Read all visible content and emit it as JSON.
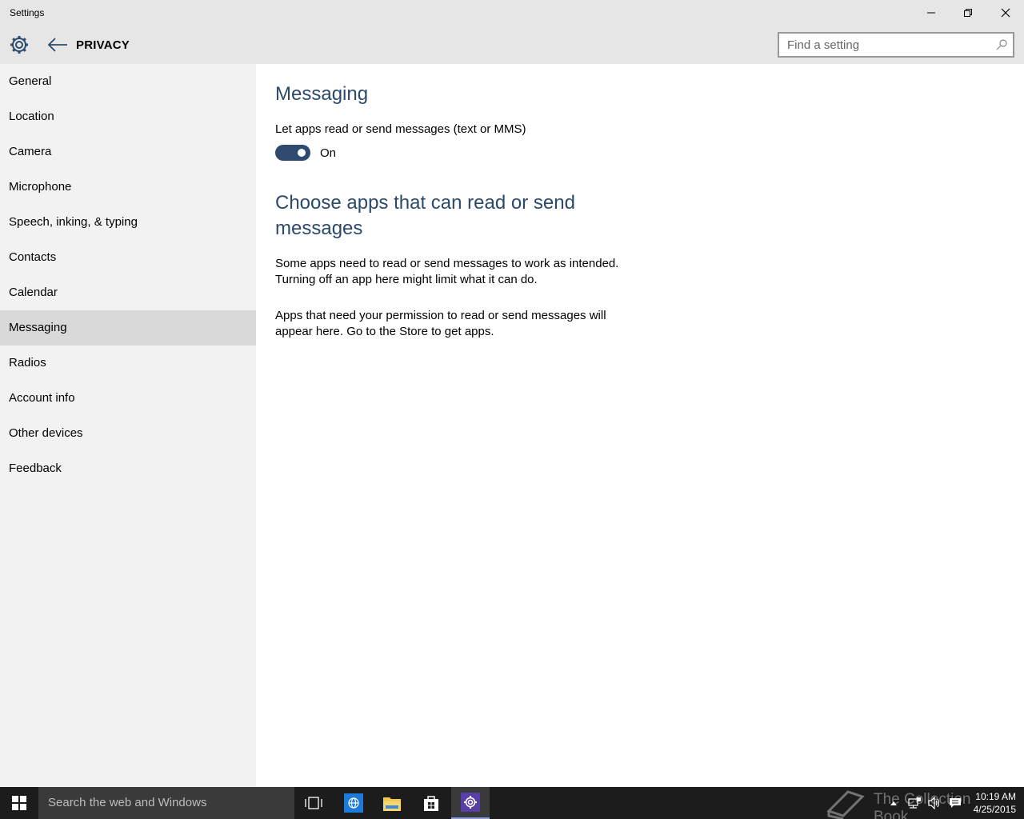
{
  "window": {
    "title": "Settings"
  },
  "header": {
    "section_title": "PRIVACY",
    "search_placeholder": "Find a setting"
  },
  "sidebar": {
    "items": [
      {
        "label": "General"
      },
      {
        "label": "Location"
      },
      {
        "label": "Camera"
      },
      {
        "label": "Microphone"
      },
      {
        "label": "Speech, inking, & typing"
      },
      {
        "label": "Contacts"
      },
      {
        "label": "Calendar"
      },
      {
        "label": "Messaging",
        "selected": true
      },
      {
        "label": "Radios"
      },
      {
        "label": "Account info"
      },
      {
        "label": "Other devices"
      },
      {
        "label": "Feedback"
      }
    ]
  },
  "content": {
    "heading": "Messaging",
    "toggle_label": "Let apps read or send messages (text or MMS)",
    "toggle_state": "On",
    "subheading": "Choose apps that can read or send messages",
    "paragraph1": "Some apps need to read or send messages to work as intended. Turning off an app here might limit what it can do.",
    "paragraph2": "Apps that need your permission to read or send messages will appear here. Go to the Store to get apps."
  },
  "taskbar": {
    "search_placeholder": "Search the web and Windows",
    "watermark_text": "The Collection Book",
    "time": "10:19 AM",
    "date": "4/25/2015"
  },
  "colors": {
    "accent": "#2e4a6e",
    "heading": "#2b4a6b",
    "sidebar_bg": "#f2f2f2",
    "titlebar_bg": "#e6e6e6",
    "taskbar_bg": "#1c1c1c"
  }
}
